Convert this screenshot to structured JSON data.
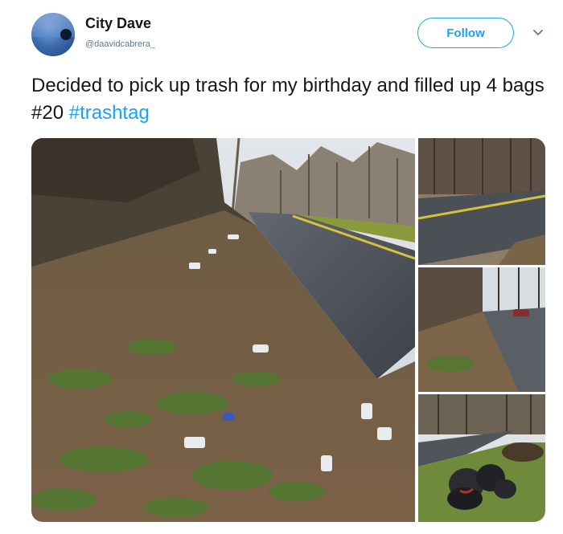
{
  "author": {
    "name": "City Dave",
    "handle": "@daavidcabrera_"
  },
  "follow_label": "Follow",
  "tweet": {
    "text": "Decided to pick up trash for my birthday and filled up 4 bags #20 ",
    "hashtag": "#trashtag"
  },
  "icons": {
    "menu": "chevron-down-icon"
  },
  "colors": {
    "accent": "#1da1f2",
    "text": "#14171a",
    "secondary": "#657786"
  }
}
